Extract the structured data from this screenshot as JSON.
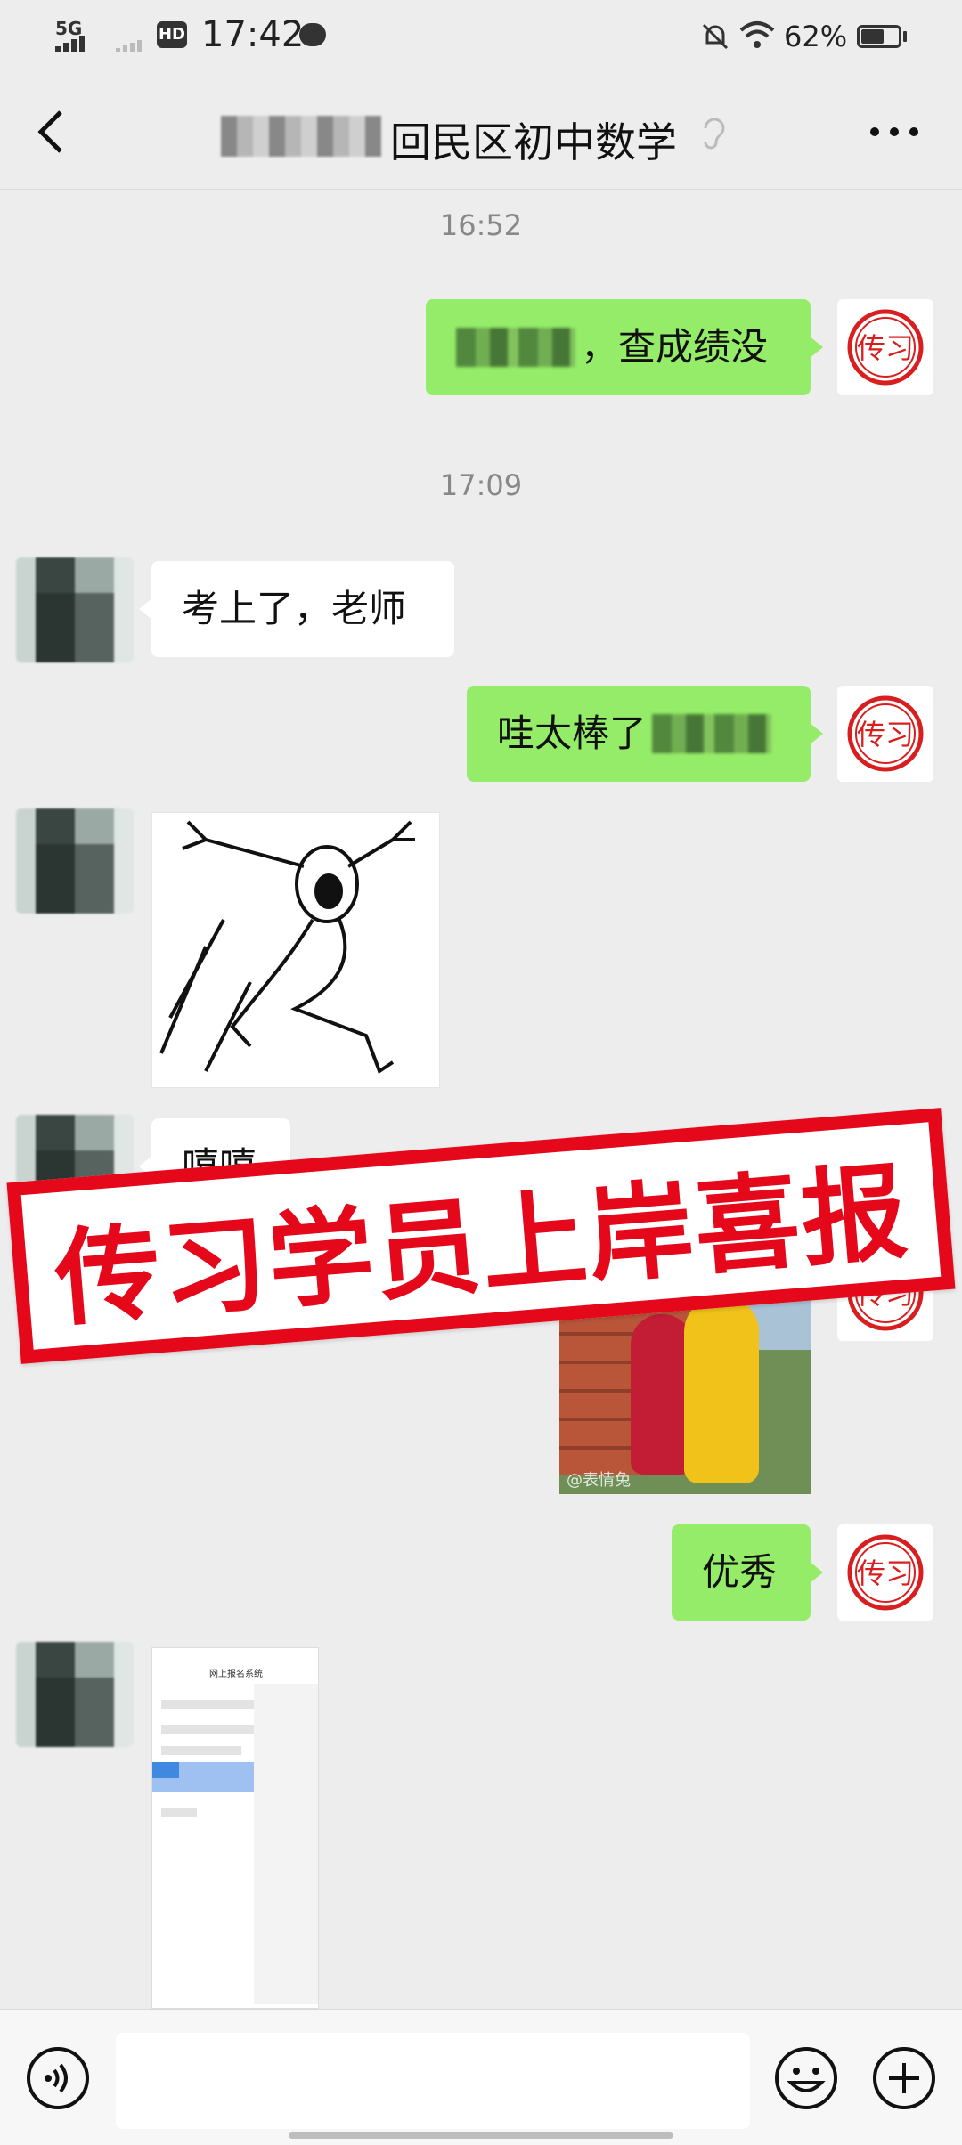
{
  "status_bar": {
    "network": "5G",
    "hd_label": "HD",
    "time": "17:42",
    "battery_percent": "62%",
    "battery_level": 0.62
  },
  "nav": {
    "title": "回民区初中数学",
    "back_icon": "chevron-left-icon",
    "ear_icon": "ear-icon",
    "more_icon": "more-dots-icon"
  },
  "messages": {
    "time_1": "16:52",
    "m1_text": "，查成绩没",
    "time_2": "17:09",
    "m2_text": "考上了，老师",
    "m3_text": "哇太棒了",
    "m5_text": "嘻嘻",
    "m7_text": "优秀"
  },
  "stickers": {
    "tubby_watermark": "@表情兔"
  },
  "screenshot_thumb": {
    "title": "网上报名系统"
  },
  "banner": {
    "text": "传习学员上岸喜报"
  },
  "avatar_self": {
    "text": "传习"
  },
  "input_bar": {
    "voice_icon": "voice-icon",
    "emoji_icon": "emoji-icon",
    "plus_icon": "plus-icon"
  },
  "colors": {
    "green_bubble": "#95ec69",
    "banner_red": "#e5071a",
    "background": "#ededed"
  }
}
